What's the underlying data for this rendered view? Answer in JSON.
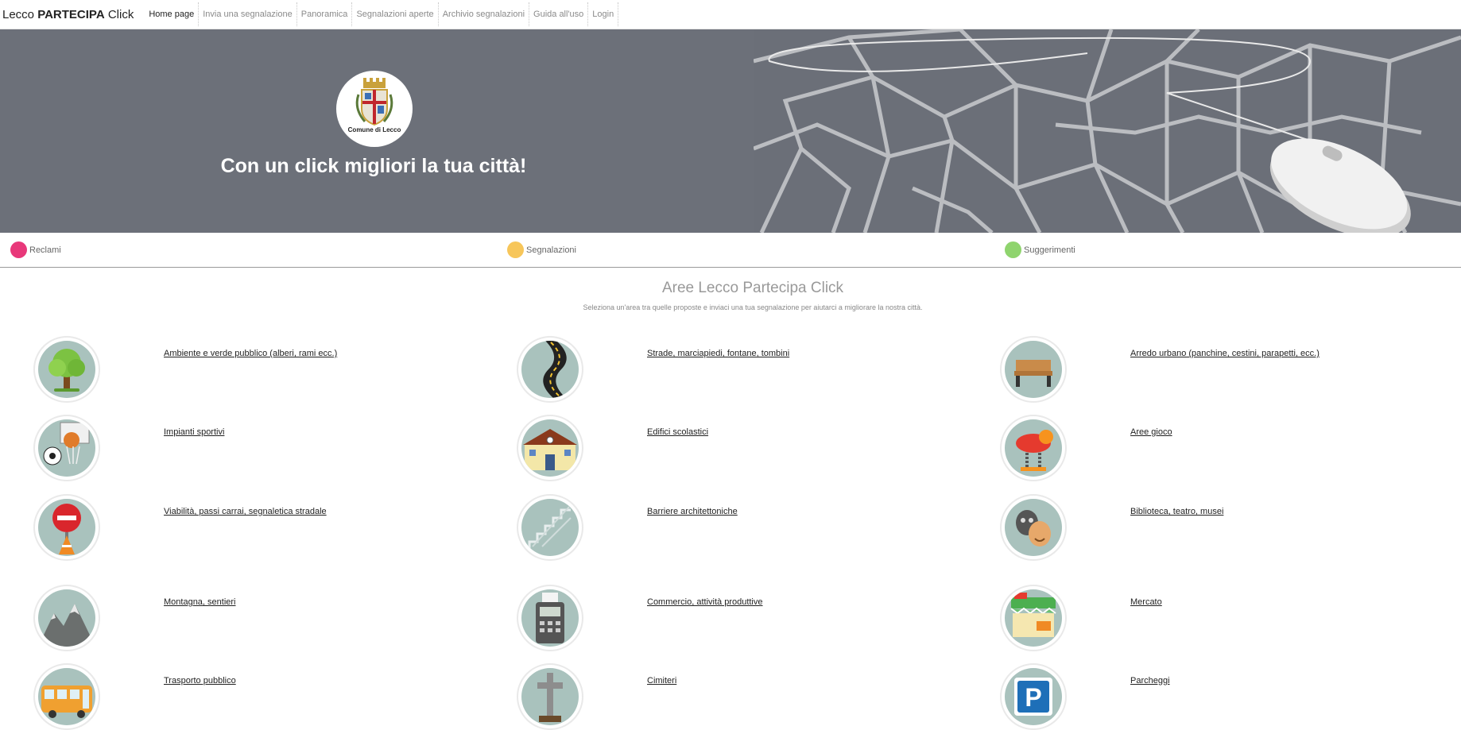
{
  "brand": {
    "prefix": "Lecco ",
    "bold": "PARTECIPA",
    "suffix": " Click"
  },
  "nav": [
    {
      "label": "Home page",
      "active": true
    },
    {
      "label": "Invia una segnalazione",
      "active": false
    },
    {
      "label": "Panoramica",
      "active": false
    },
    {
      "label": "Segnalazioni aperte",
      "active": false
    },
    {
      "label": "Archivio segnalazioni",
      "active": false
    },
    {
      "label": "Guida all'uso",
      "active": false
    },
    {
      "label": "Login",
      "active": false
    }
  ],
  "hero": {
    "logo_text": "Comune di Lecco",
    "title": "Con un click migliori la tua città!"
  },
  "legend": [
    {
      "label": "Reclami",
      "color": "#e8387a"
    },
    {
      "label": "Segnalazioni",
      "color": "#f7c65a"
    },
    {
      "label": "Suggerimenti",
      "color": "#8fd46e"
    }
  ],
  "areas_section": {
    "title": "Aree Lecco Partecipa Click",
    "subtitle": "Seleziona un'area tra quelle proposte e inviaci una tua segnalazione per aiutarci a migliorare la nostra città."
  },
  "areas": [
    {
      "label": "Ambiente e verde pubblico (alberi, rami ecc.)",
      "icon": "tree-icon"
    },
    {
      "label": "Strade, marciapiedi, fontane, tombini",
      "icon": "road-icon"
    },
    {
      "label": "Arredo urbano (panchine, cestini, parapetti, ecc.)",
      "icon": "bench-icon"
    },
    {
      "label": "Impianti sportivi",
      "icon": "basketball-hoop-icon"
    },
    {
      "label": "Edifici scolastici",
      "icon": "school-icon"
    },
    {
      "label": "Aree gioco",
      "icon": "spring-rider-icon"
    },
    {
      "label": "Viabilità, passi carrai, segnaletica stradale",
      "icon": "no-entry-sign-icon"
    },
    {
      "label": "Barriere architettoniche",
      "icon": "stairs-icon"
    },
    {
      "label": "Biblioteca, teatro, musei",
      "icon": "theatre-masks-icon"
    },
    {
      "label": "Montagna, sentieri",
      "icon": "mountain-icon"
    },
    {
      "label": "Commercio, attività produttive",
      "icon": "cash-register-icon"
    },
    {
      "label": "Mercato",
      "icon": "market-stall-icon"
    },
    {
      "label": "Trasporto pubblico",
      "icon": "bus-icon"
    },
    {
      "label": "Cimiteri",
      "icon": "cross-icon"
    },
    {
      "label": "Parcheggi",
      "icon": "parking-icon"
    }
  ]
}
